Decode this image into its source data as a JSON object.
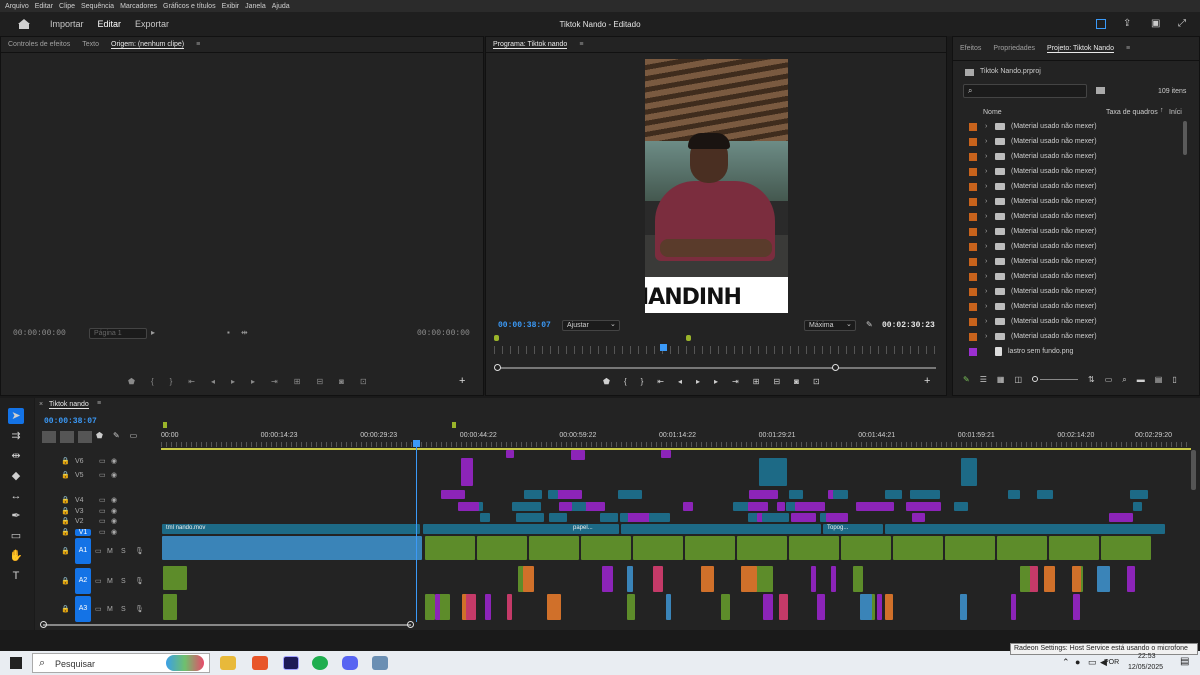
{
  "menu": [
    "Arquivo",
    "Editar",
    "Clipe",
    "Sequência",
    "Marcadores",
    "Gráficos e títulos",
    "Exibir",
    "Janela",
    "Ajuda"
  ],
  "header": {
    "workspaces": [
      "Importar",
      "Editar",
      "Exportar"
    ],
    "active_workspace": "Editar",
    "title": "Tiktok Nando - Editado"
  },
  "source_panel": {
    "tabs": [
      "Controles de efeitos",
      "Texto",
      "Origem: (nenhum clipe)"
    ],
    "timecode_left": "00:00:00:00",
    "page_dropdown": "Página 1",
    "timecode_right": "00:00:00:00"
  },
  "program_panel": {
    "tab": "Programa: Tiktok nando",
    "timecode_current": "00:00:38:07",
    "fit_dropdown": "Ajustar",
    "quality_dropdown": "Máxima",
    "timecode_duration": "00:02:30:23",
    "overlay_text": "IANDINH"
  },
  "project_panel": {
    "tabs": [
      "Efeitos",
      "Propriedades",
      "Projeto: Tiktok Nando"
    ],
    "file": "Tiktok Nando.prproj",
    "search_placeholder": "",
    "item_count": "109 itens",
    "columns": [
      "Nome",
      "Taxa de quadros",
      "Iníci"
    ],
    "rows": [
      {
        "label": "(Material usado não mexer)",
        "color": "#c8631c",
        "type": "folder"
      },
      {
        "label": "(Material usado não mexer)",
        "color": "#c8631c",
        "type": "folder"
      },
      {
        "label": "(Material usado não mexer)",
        "color": "#c8631c",
        "type": "folder"
      },
      {
        "label": "(Material usado não mexer)",
        "color": "#c8631c",
        "type": "folder"
      },
      {
        "label": "(Material usado não mexer)",
        "color": "#c8631c",
        "type": "folder"
      },
      {
        "label": "(Material usado não mexer)",
        "color": "#c8631c",
        "type": "folder"
      },
      {
        "label": "(Material usado não mexer)",
        "color": "#c8631c",
        "type": "folder"
      },
      {
        "label": "(Material usado não mexer)",
        "color": "#c8631c",
        "type": "folder"
      },
      {
        "label": "(Material usado não mexer)",
        "color": "#c8631c",
        "type": "folder"
      },
      {
        "label": "(Material usado não mexer)",
        "color": "#c8631c",
        "type": "folder"
      },
      {
        "label": "(Material usado não mexer)",
        "color": "#c8631c",
        "type": "folder"
      },
      {
        "label": "(Material usado não mexer)",
        "color": "#c8631c",
        "type": "folder"
      },
      {
        "label": "(Material usado não mexer)",
        "color": "#c8631c",
        "type": "folder"
      },
      {
        "label": "(Material usado não mexer)",
        "color": "#c8631c",
        "type": "folder"
      },
      {
        "label": "(Material usado não mexer)",
        "color": "#c8631c",
        "type": "folder"
      },
      {
        "label": "lastro sem fundo.png",
        "color": "#9b2fd0",
        "type": "file"
      }
    ]
  },
  "timeline": {
    "tab": "Tiktok nando",
    "timecode": "00:00:38:07",
    "ruler": [
      "00:00",
      "00:00:14:23",
      "00:00:29:23",
      "00:00:44:22",
      "00:00:59:22",
      "00:01:14:22",
      "00:01:29:21",
      "00:01:44:21",
      "00:01:59:21",
      "00:02:14:20",
      "00:02:29:20"
    ],
    "video_tracks": [
      "V6",
      "V5",
      "V4",
      "V3",
      "V2",
      "V1"
    ],
    "audio_tracks": [
      "A1",
      "A2",
      "A3"
    ],
    "clip_labels": {
      "v1_main": "tml nando.mov",
      "v1_papel": "papel...",
      "v1_topog": "Topog..."
    },
    "fx": "fx",
    "ms": [
      "M",
      "S"
    ]
  },
  "taskbar": {
    "search": "Pesquisar",
    "notification": "Radeon Settings: Host Service está usando o microfone",
    "lang": "POR",
    "time": "22:53",
    "date": "12/05/2025"
  },
  "colors": {
    "accent": "#3b9af8",
    "video_teal": "#1d6a86",
    "purple": "#8c24b8",
    "audio_green": "#5d8c2a",
    "audio_blue": "#3a84b8"
  }
}
